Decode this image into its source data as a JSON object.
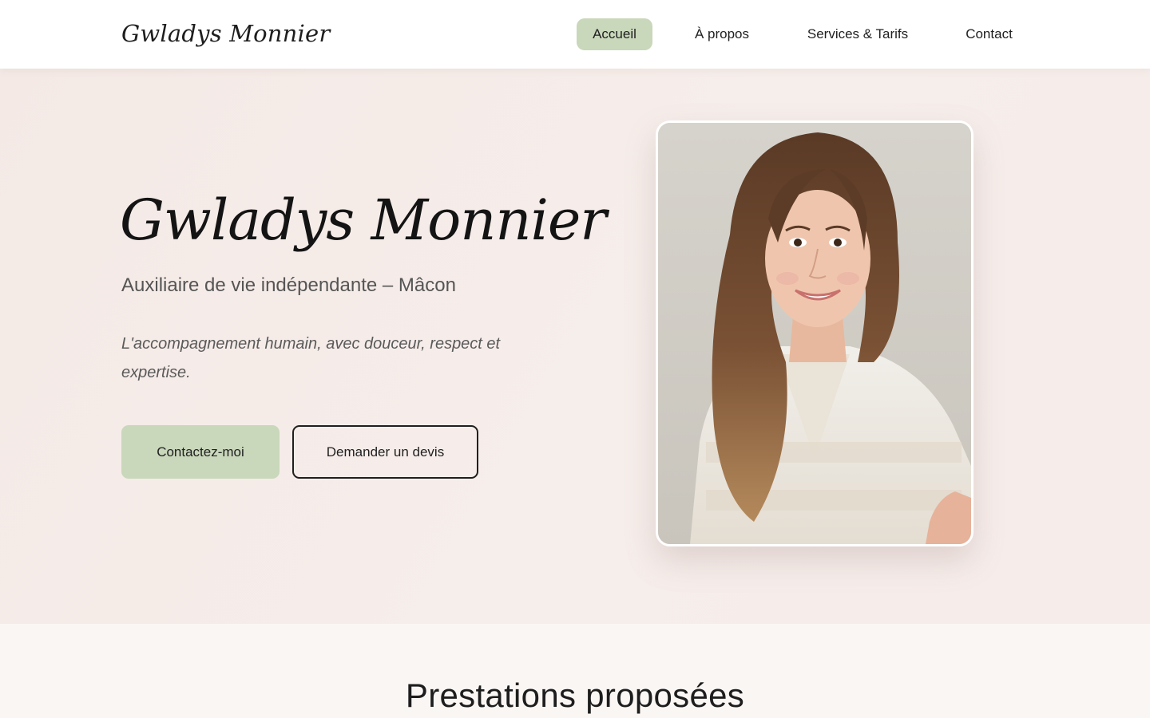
{
  "header": {
    "logo_text": "Gwladys Monnier",
    "nav": [
      {
        "label": "Accueil",
        "active": true
      },
      {
        "label": "À propos",
        "active": false
      },
      {
        "label": "Services & Tarifs",
        "active": false
      },
      {
        "label": "Contact",
        "active": false
      }
    ]
  },
  "hero": {
    "title": "Gwladys Monnier",
    "subtitle": "Auxiliaire de vie indépendante – Mâcon",
    "tagline": "L'accompagnement humain, avec douceur, respect et expertise.",
    "primary_button": "Contactez-moi",
    "secondary_button": "Demander un devis"
  },
  "services": {
    "title": "Prestations proposées"
  },
  "colors": {
    "accent": "#c9d7bb",
    "hero_background": "#f5ece9",
    "text": "#1f1f1f"
  }
}
